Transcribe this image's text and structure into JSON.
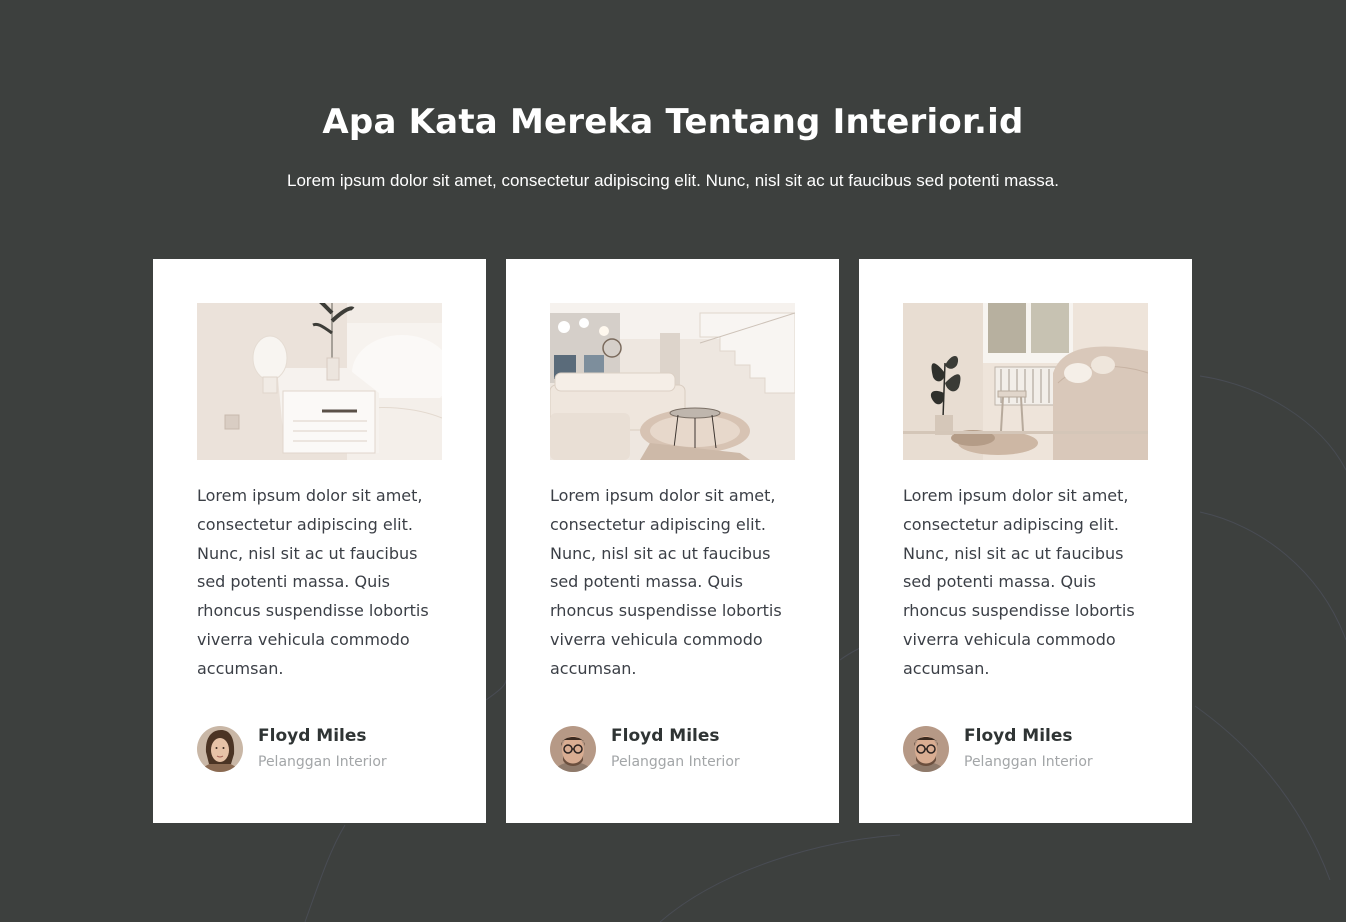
{
  "section": {
    "title": "Apa Kata Mereka Tentang Interior.id",
    "subtitle": "Lorem ipsum dolor sit amet, consectetur adipiscing elit. Nunc, nisl sit ac ut faucibus sed potenti massa."
  },
  "testimonials": [
    {
      "photo": "bedroom-nightstand-photo",
      "text": "Lorem ipsum dolor sit amet, consectetur adipiscing elit. Nunc, nisl sit ac ut faucibus sed potenti massa. Quis rhoncus suspendisse lobortis viverra vehicula commodo accumsan.",
      "name": "Floyd Miles",
      "role": "Pelanggan Interior",
      "avatar": "woman-avatar"
    },
    {
      "photo": "living-room-stairs-photo",
      "text": "Lorem ipsum dolor sit amet, consectetur adipiscing elit. Nunc, nisl sit ac ut faucibus sed potenti massa. Quis rhoncus suspendisse lobortis viverra vehicula commodo accumsan.",
      "name": "Floyd Miles",
      "role": "Pelanggan Interior",
      "avatar": "man-glasses-avatar"
    },
    {
      "photo": "cozy-sofa-room-photo",
      "text": "Lorem ipsum dolor sit amet, consectetur adipiscing elit. Nunc, nisl sit ac ut faucibus sed potenti massa. Quis rhoncus suspendisse lobortis viverra vehicula commodo accumsan.",
      "name": "Floyd Miles",
      "role": "Pelanggan Interior",
      "avatar": "man-glasses-avatar"
    }
  ],
  "colors": {
    "background": "#3d403e",
    "card": "#ffffff",
    "text": "#3b3f46",
    "muted": "#a3a6a8"
  }
}
